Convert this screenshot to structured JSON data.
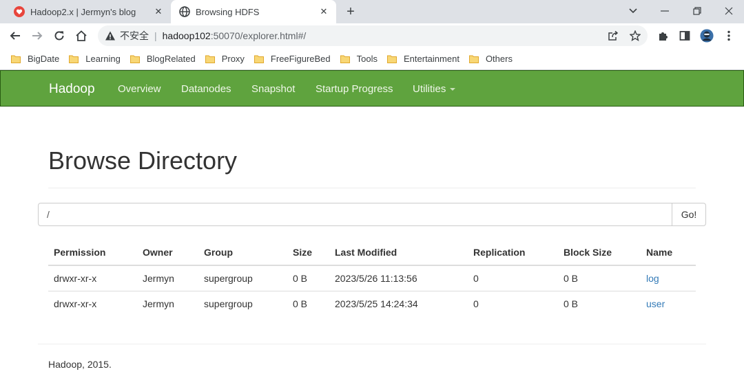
{
  "browser": {
    "tabs": [
      {
        "title": "Hadoop2.x | Jermyn's blog",
        "favicon": "heart-icon",
        "active": false
      },
      {
        "title": "Browsing HDFS",
        "favicon": "globe-icon",
        "active": true
      }
    ],
    "address": {
      "security_label": "不安全",
      "host": "hadoop102",
      "path": ":50070/explorer.html#/"
    },
    "bookmarks": [
      "BigDate",
      "Learning",
      "BlogRelated",
      "Proxy",
      "FreeFigureBed",
      "Tools",
      "Entertainment",
      "Others"
    ],
    "colors": {
      "tab_strip": "#dee1e6",
      "folder": "#f6c34a"
    }
  },
  "hadoop_nav": {
    "brand": "Hadoop",
    "items": [
      "Overview",
      "Datanodes",
      "Snapshot",
      "Startup Progress",
      "Utilities"
    ],
    "color": "#5fa33e"
  },
  "main": {
    "title": "Browse Directory",
    "path_value": "/",
    "go_label": "Go!",
    "columns": [
      "Permission",
      "Owner",
      "Group",
      "Size",
      "Last Modified",
      "Replication",
      "Block Size",
      "Name"
    ],
    "rows": [
      [
        "drwxr-xr-x",
        "Jermyn",
        "supergroup",
        "0 B",
        "2023/5/26 11:13:56",
        "0",
        "0 B",
        "log"
      ],
      [
        "drwxr-xr-x",
        "Jermyn",
        "supergroup",
        "0 B",
        "2023/5/25 14:24:34",
        "0",
        "0 B",
        "user"
      ]
    ],
    "link_color": "#337ab7"
  },
  "footer": {
    "text": "Hadoop, 2015."
  }
}
